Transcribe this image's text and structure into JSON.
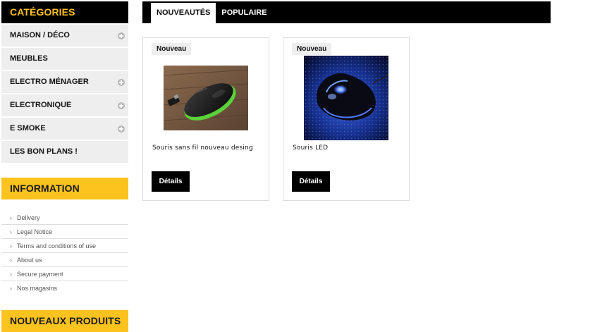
{
  "sidebar": {
    "categories_title": "CATÉGORIES",
    "categories": [
      {
        "label": "MAISON / DÉCO"
      },
      {
        "label": "MEUBLES"
      },
      {
        "label": "ELECTRO MÉNAGER"
      },
      {
        "label": "ELECTRONIQUE"
      },
      {
        "label": "E SMOKE"
      },
      {
        "label": "LES BON PLANS !"
      }
    ],
    "information_title": "INFORMATION",
    "information_links": [
      {
        "label": "Delivery"
      },
      {
        "label": "Legal Notice"
      },
      {
        "label": "Terms and conditions of use"
      },
      {
        "label": "About us"
      },
      {
        "label": "Secure payment"
      },
      {
        "label": "Nos magasins"
      }
    ],
    "new_products_title": "NOUVEAUX PRODUITS"
  },
  "tabs": [
    {
      "label": "NOUVEAUTÉS"
    },
    {
      "label": "POPULAIRE"
    }
  ],
  "products": [
    {
      "badge": "Nouveau",
      "name": "Souris sans fil nouveau desing",
      "button": "Détails"
    },
    {
      "badge": "Nouveau",
      "name": "Souris LED",
      "button": "Détails"
    }
  ],
  "colors": {
    "accent": "#fcc21e",
    "dark": "#000000",
    "panel": "#eeeeee"
  }
}
